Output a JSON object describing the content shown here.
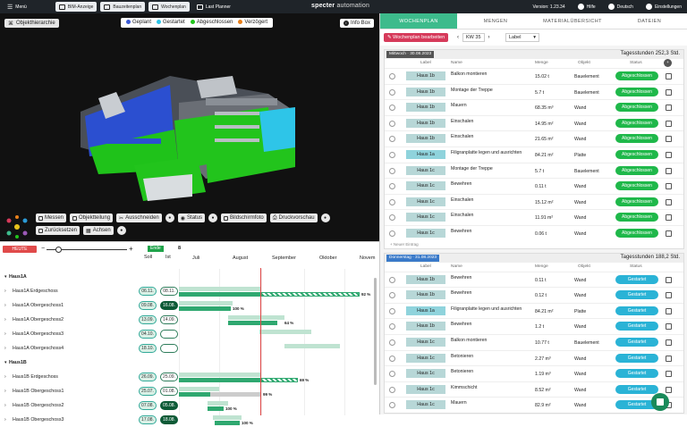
{
  "topbar": {
    "menu": "Menü",
    "bim": "BIM-Anzeige",
    "bauzeitenplan": "Bauzeitenplan",
    "wochenplan": "Wochenplan",
    "last_planner": "Last Planner",
    "brand_a": "specter",
    "brand_b": "automation",
    "version": "Version: 1.23.34",
    "hilfe": "Hilfe",
    "lang": "Deutsch",
    "settings": "Einstellungen"
  },
  "viewer": {
    "objekthierarchie": "Objekthierarchie",
    "legend": [
      {
        "label": "Geplant",
        "color": "#3b5bd6"
      },
      {
        "label": "Gestartet",
        "color": "#2ec5e8"
      },
      {
        "label": "Abgeschlossen",
        "color": "#22c41c"
      },
      {
        "label": "Verzögert",
        "color": "#e8801c"
      }
    ],
    "infobox": "Info Box",
    "tools": [
      "Messen",
      "Objektteilung",
      "Ausschneiden",
      "Status",
      "Bildschirmfoto",
      "Druckvorschau",
      "Zurücksetzen",
      "Achsen"
    ]
  },
  "gantt": {
    "heute": "HEUTE",
    "ende": "Ende",
    "ende_val": "8",
    "soll": "Soll",
    "ist": "Ist",
    "months": [
      "Juli",
      "August",
      "September",
      "Oktober",
      "Novem"
    ],
    "rows": [
      {
        "name": "Haus1A",
        "bold": true,
        "soll": "",
        "ist": ""
      },
      {
        "name": "Haus1A Erdgeschoss",
        "soll": "06.11.",
        "ist": "08.11.",
        "iststyle": "empty",
        "plan": [
          200,
          292
        ],
        "act": [
          200,
          292
        ],
        "hatch": [
          292,
          402
        ],
        "pct": "92 %",
        "pctx": 404
      },
      {
        "name": "Haus1A Obergeschoss1",
        "soll": "09.08.",
        "ist": "16.08.",
        "iststyle": "dark",
        "plan": [
          200,
          260
        ],
        "act": [
          200,
          258
        ],
        "pct": "100 %",
        "pctx": 260
      },
      {
        "name": "Haus1A Obergeschoss2",
        "soll": "13.09.",
        "ist": "14.09.",
        "iststyle": "empty",
        "plan": [
          255,
          318
        ],
        "act": [
          255,
          310
        ],
        "pct": "64 %",
        "pctx": 318
      },
      {
        "name": "Haus1A Obergeschoss3",
        "soll": "04.10.",
        "ist": "",
        "iststyle": "empty",
        "plan": [
          290,
          348
        ]
      },
      {
        "name": "Haus1A Obergeschoss4",
        "soll": "18.10.",
        "ist": "",
        "iststyle": "empty",
        "plan": [
          318,
          380
        ]
      },
      {
        "name": "Haus1B",
        "bold": true,
        "soll": "",
        "ist": ""
      },
      {
        "name": "Haus1B Erdgeschoss",
        "soll": "26.09.",
        "ist": "25.09.",
        "iststyle": "empty",
        "plan": [
          200,
          292
        ],
        "act": [
          200,
          292
        ],
        "hatch": [
          292,
          333
        ],
        "pct": "69 %",
        "pctx": 335
      },
      {
        "name": "Haus1B Obergeschoss1",
        "soll": "25.07.",
        "ist": "01.08.",
        "iststyle": "empty",
        "plan": [
          200,
          245
        ],
        "act": [
          200,
          235
        ],
        "gray": [
          235,
          292
        ],
        "pct": "99 %",
        "pctx": 294
      },
      {
        "name": "Haus1B Obergeschoss2",
        "soll": "07.08.",
        "ist": "05.08.",
        "iststyle": "dark",
        "plan": [
          232,
          255
        ],
        "act": [
          232,
          250
        ],
        "pct": "100 %",
        "pctx": 252
      },
      {
        "name": "Haus1B Obergeschoss3",
        "soll": "17.08.",
        "ist": "18.08.",
        "iststyle": "dark",
        "plan": [
          238,
          270
        ],
        "act": [
          240,
          268
        ],
        "pct": "100 %",
        "pctx": 270
      }
    ]
  },
  "panel": {
    "tabs": [
      "WOCHENPLAN",
      "MENGEN",
      "MATERIALÜBERSICHT",
      "DATEIEN"
    ],
    "edit": "Wochenplan bearbeiten",
    "kw": "KW 35",
    "label_sel": "Label",
    "cols": {
      "label": "Label",
      "name": "Name",
      "menge": "Menge",
      "objekt": "Objekt",
      "status": "Status"
    },
    "add": "+ Neuer Eintrag",
    "days": [
      {
        "date": "Mittwoch · 30.08.2023",
        "hours": "Tagesstunden 252,3 Std.",
        "rows": [
          {
            "label": "Haus 1b",
            "name": "Balkon montieren",
            "menge": "15.02 t",
            "objekt": "Bauelement",
            "status": "Abgeschlossen"
          },
          {
            "label": "Haus 1b",
            "name": "Montage der Treppe",
            "menge": "5.7 t",
            "objekt": "Bauelement",
            "status": "Abgeschlossen"
          },
          {
            "label": "Haus 1b",
            "name": "Mauern",
            "menge": "68.35 m³",
            "objekt": "Wand",
            "status": "Abgeschlossen"
          },
          {
            "label": "Haus 1b",
            "name": "Einschalen",
            "menge": "14.95 m²",
            "objekt": "Wand",
            "status": "Abgeschlossen"
          },
          {
            "label": "Haus 1b",
            "name": "Einschalen",
            "menge": "21.65 m²",
            "objekt": "Wand",
            "status": "Abgeschlossen"
          },
          {
            "label": "Haus 1a",
            "name": "Filigranplatte legen und ausrichten",
            "menge": "84.21 m²",
            "objekt": "Platte",
            "status": "Abgeschlossen",
            "hl": true
          },
          {
            "label": "Haus 1c",
            "name": "Montage der Treppe",
            "menge": "5.7 t",
            "objekt": "Bauelement",
            "status": "Abgeschlossen"
          },
          {
            "label": "Haus 1c",
            "name": "Bewehren",
            "menge": "0.11 t",
            "objekt": "Wand",
            "status": "Abgeschlossen"
          },
          {
            "label": "Haus 1c",
            "name": "Einschalen",
            "menge": "15.12 m²",
            "objekt": "Wand",
            "status": "Abgeschlossen"
          },
          {
            "label": "Haus 1c",
            "name": "Einschalen",
            "menge": "11.91 m²",
            "objekt": "Wand",
            "status": "Abgeschlossen"
          },
          {
            "label": "Haus 1c",
            "name": "Bewehren",
            "menge": "0.06 t",
            "objekt": "Wand",
            "status": "Abgeschlossen"
          }
        ]
      },
      {
        "date": "Donnerstag · 31.08.2023",
        "hours": "Tagesstunden 188,2 Std.",
        "rows": [
          {
            "label": "Haus 1b",
            "name": "Bewehren",
            "menge": "0.11 t",
            "objekt": "Wand",
            "status": "Gestartet"
          },
          {
            "label": "Haus 1b",
            "name": "Bewehren",
            "menge": "0.12 t",
            "objekt": "Wand",
            "status": "Gestartet"
          },
          {
            "label": "Haus 1a",
            "name": "Filigranplatte legen und ausrichten",
            "menge": "84.21 m²",
            "objekt": "Platte",
            "status": "Gestartet",
            "hl": true
          },
          {
            "label": "Haus 1b",
            "name": "Bewehren",
            "menge": "1.2 t",
            "objekt": "Wand",
            "status": "Gestartet"
          },
          {
            "label": "Haus 1c",
            "name": "Balkon montieren",
            "menge": "10.77 t",
            "objekt": "Bauelement",
            "status": "Gestartet"
          },
          {
            "label": "Haus 1c",
            "name": "Betonieren",
            "menge": "2.27 m³",
            "objekt": "Wand",
            "status": "Gestartet"
          },
          {
            "label": "Haus 1c",
            "name": "Betonieren",
            "menge": "1.19 m³",
            "objekt": "Wand",
            "status": "Gestartet"
          },
          {
            "label": "Haus 1c",
            "name": "Kimmschicht",
            "menge": "8.52 m²",
            "objekt": "Wand",
            "status": "Gestartet"
          },
          {
            "label": "Haus 1c",
            "name": "Mauern",
            "menge": "82.9 m²",
            "objekt": "Wand",
            "status": "Gestartet"
          }
        ]
      }
    ]
  }
}
